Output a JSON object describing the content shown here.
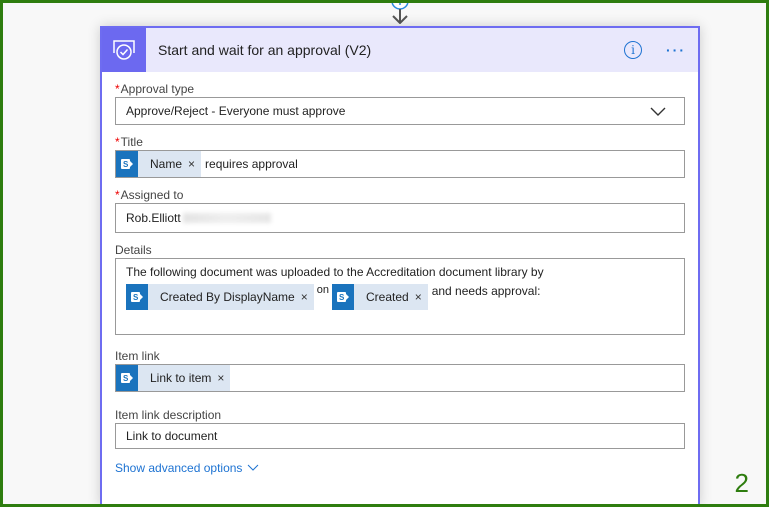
{
  "card": {
    "title": "Start and wait for an approval (V2)",
    "icon": "approval-icon",
    "info_icon": "info-icon",
    "more_icon": "more-options-icon",
    "accent_color": "#6c69f0",
    "header_bg": "#e9e8fc"
  },
  "fields": {
    "approval_type": {
      "label": "Approval type",
      "required": "*",
      "value": "Approve/Reject - Everyone must approve"
    },
    "title": {
      "label": "Title",
      "required": "*",
      "token": "Name",
      "text": "requires approval"
    },
    "assigned_to": {
      "label": "Assigned to",
      "required": "*",
      "value": "Rob.Elliott"
    },
    "details": {
      "label": "Details",
      "line1": "The following document was uploaded to the Accreditation document library by",
      "token1": "Created By DisplayName",
      "between": "on",
      "token2": "Created",
      "after": "and needs approval:"
    },
    "item_link": {
      "label": "Item link",
      "token": "Link to item"
    },
    "item_link_description": {
      "label": "Item link description",
      "value": "Link to document"
    }
  },
  "advanced_label": "Show advanced options",
  "token_remove": "×",
  "step_number": "2",
  "frame_color": "#2e7d0f"
}
